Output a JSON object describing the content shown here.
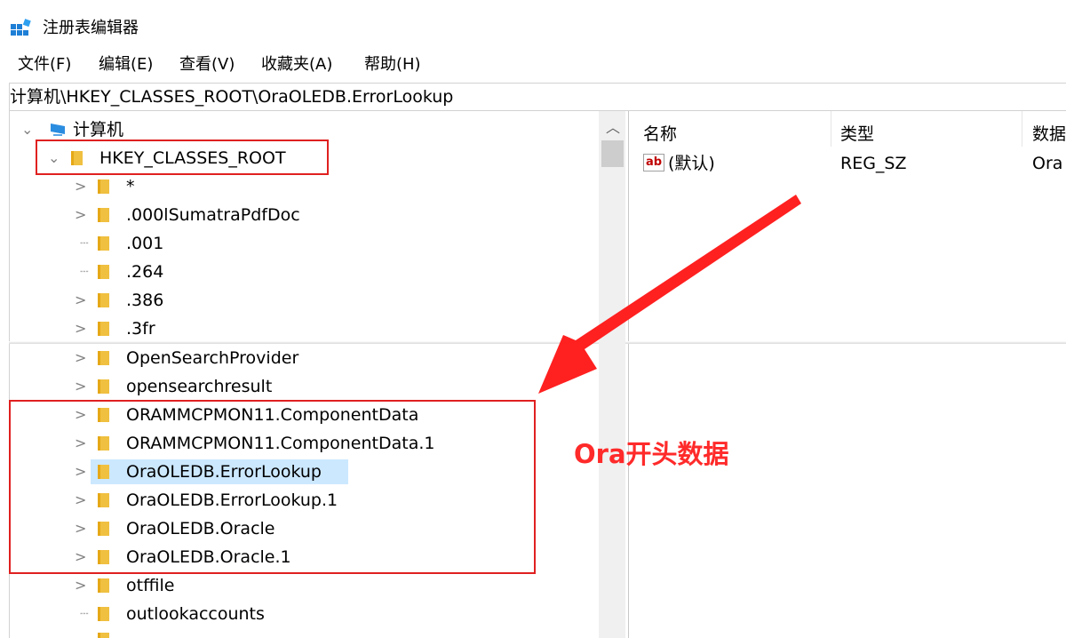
{
  "window": {
    "title": "注册表编辑器"
  },
  "menu": [
    "文件(F)",
    "编辑(E)",
    "查看(V)",
    "收藏夹(A)",
    "帮助(H)"
  ],
  "address": "计算机\\HKEY_CLASSES_ROOT\\OraOLEDB.ErrorLookup",
  "tree": {
    "root_label": "计算机",
    "hive_label": "HKEY_CLASSES_ROOT",
    "top_keys": [
      "*",
      ".000lSumatraPdfDoc",
      ".001",
      ".264",
      ".386",
      ".3fr"
    ],
    "bottom_keys": [
      "OpenSearchProvider",
      "opensearchresult",
      "ORAMMCPMON11.ComponentData",
      "ORAMMCPMON11.ComponentData.1",
      "OraOLEDB.ErrorLookup",
      "OraOLEDB.ErrorLookup.1",
      "OraOLEDB.Oracle",
      "OraOLEDB.Oracle.1",
      "otffile",
      "outlookaccounts"
    ],
    "selected": "OraOLEDB.ErrorLookup"
  },
  "list": {
    "columns": [
      "名称",
      "类型",
      "数据"
    ],
    "rows": [
      {
        "name": "(默认)",
        "type": "REG_SZ",
        "data": "Ora"
      }
    ]
  },
  "annotation": {
    "text": "Ora开头数据",
    "color": "#ff2a2a"
  },
  "colors": {
    "selection": "#cce8ff",
    "folder": "#f0c040",
    "annotation_red": "#e02020"
  }
}
